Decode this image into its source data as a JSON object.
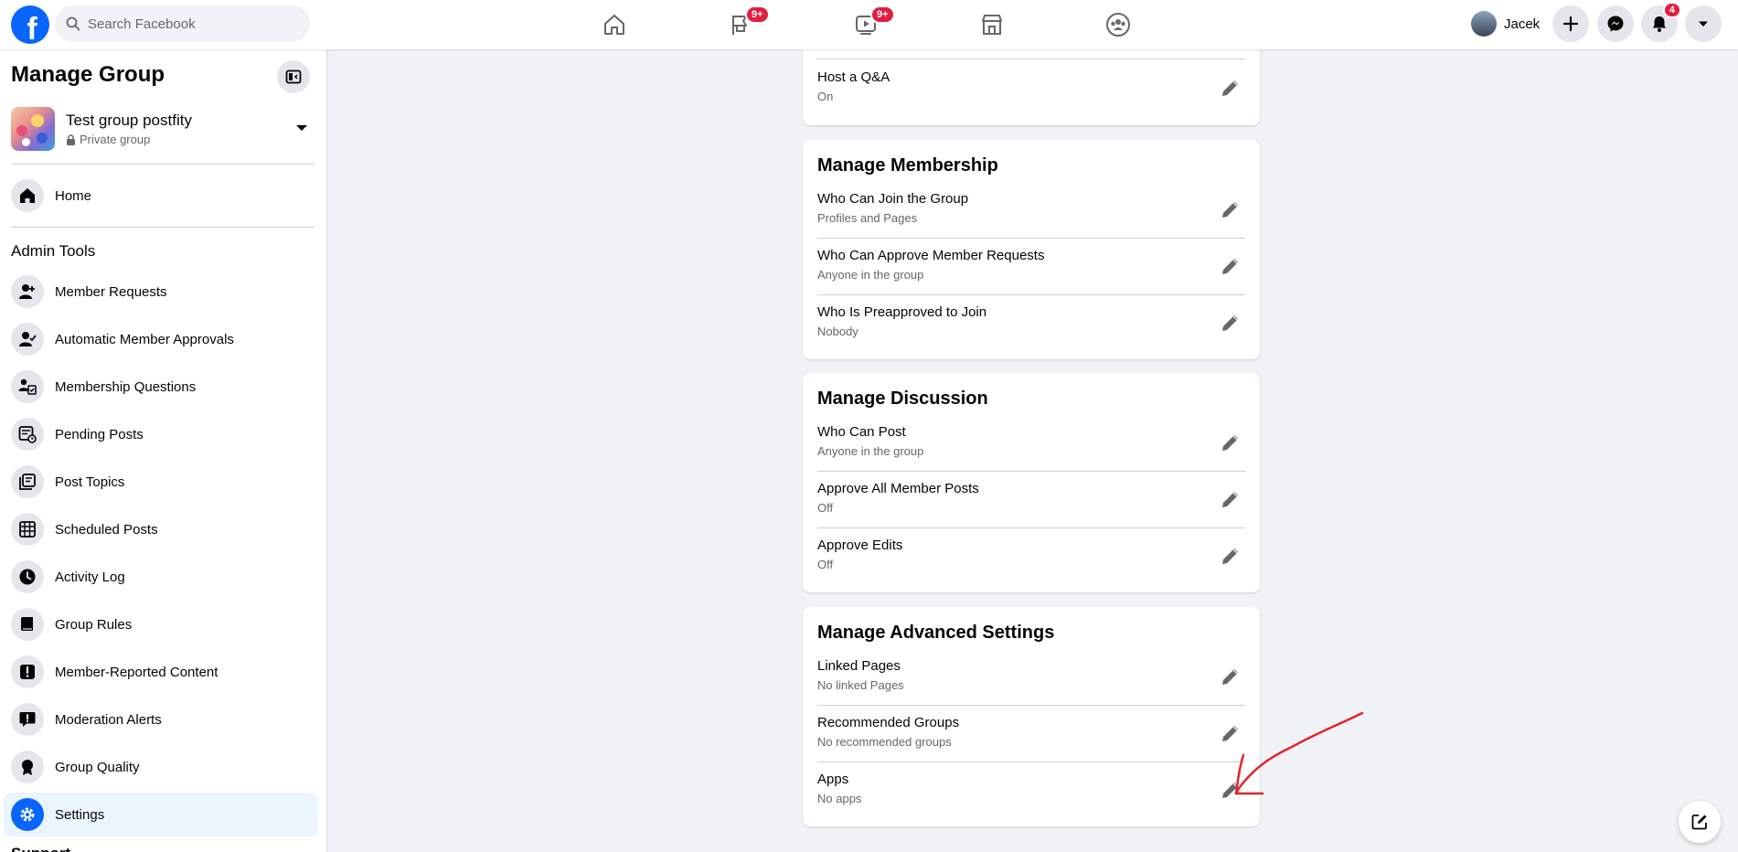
{
  "topbar": {
    "logo_letter": "f",
    "search_placeholder": "Search Facebook",
    "nav": [
      {
        "icon": "home-icon",
        "badge": ""
      },
      {
        "icon": "flag-icon",
        "badge": "9+"
      },
      {
        "icon": "video-icon",
        "badge": "9+"
      },
      {
        "icon": "marketplace-icon",
        "badge": ""
      },
      {
        "icon": "groups-icon",
        "badge": ""
      }
    ],
    "profile_name": "Jacek",
    "notifications_badge": "4"
  },
  "sidebar": {
    "title": "Manage Group",
    "group_name": "Test group postfity",
    "group_privacy": "Private group",
    "home_label": "Home",
    "section_title": "Admin Tools",
    "items": [
      {
        "label": "Member Requests",
        "icon": "member-requests-icon"
      },
      {
        "label": "Automatic Member Approvals",
        "icon": "auto-approval-icon"
      },
      {
        "label": "Membership Questions",
        "icon": "membership-questions-icon"
      },
      {
        "label": "Pending Posts",
        "icon": "pending-posts-icon"
      },
      {
        "label": "Post Topics",
        "icon": "post-topics-icon"
      },
      {
        "label": "Scheduled Posts",
        "icon": "scheduled-posts-icon"
      },
      {
        "label": "Activity Log",
        "icon": "clock-icon"
      },
      {
        "label": "Group Rules",
        "icon": "book-icon"
      },
      {
        "label": "Member-Reported Content",
        "icon": "report-icon"
      },
      {
        "label": "Moderation Alerts",
        "icon": "alert-icon"
      },
      {
        "label": "Group Quality",
        "icon": "quality-icon"
      },
      {
        "label": "Settings",
        "icon": "gear-icon"
      }
    ],
    "partial_section": "Support"
  },
  "main": {
    "top_card": {
      "rows": [
        {
          "name": "Host a Q&A",
          "value": "On"
        }
      ]
    },
    "membership": {
      "title": "Manage Membership",
      "rows": [
        {
          "name": "Who Can Join the Group",
          "value": "Profiles and Pages"
        },
        {
          "name": "Who Can Approve Member Requests",
          "value": "Anyone in the group"
        },
        {
          "name": "Who Is Preapproved to Join",
          "value": "Nobody"
        }
      ]
    },
    "discussion": {
      "title": "Manage Discussion",
      "rows": [
        {
          "name": "Who Can Post",
          "value": "Anyone in the group"
        },
        {
          "name": "Approve All Member Posts",
          "value": "Off"
        },
        {
          "name": "Approve Edits",
          "value": "Off"
        }
      ]
    },
    "advanced": {
      "title": "Manage Advanced Settings",
      "rows": [
        {
          "name": "Linked Pages",
          "value": "No linked Pages"
        },
        {
          "name": "Recommended Groups",
          "value": "No recommended groups"
        },
        {
          "name": "Apps",
          "value": "No apps"
        }
      ]
    }
  },
  "colors": {
    "brand": "#0866ff",
    "badge": "#e41e3f",
    "annotation": "#e0242a"
  }
}
